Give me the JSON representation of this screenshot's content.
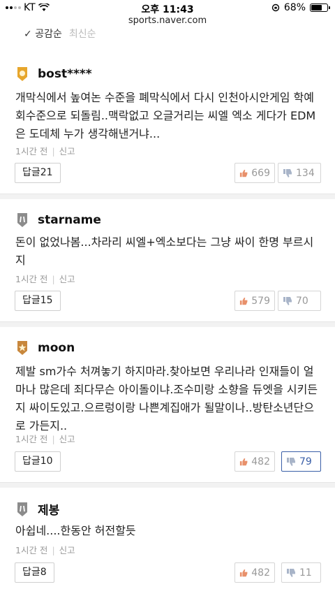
{
  "status_bar": {
    "carrier": "KT",
    "time": "오후 11:43",
    "battery": "68%",
    "battery_level": 0.68
  },
  "url": "sports.naver.com",
  "sort_tabs": {
    "active": "공감순",
    "inactive": "최신순"
  },
  "comments": [
    {
      "author": "bost****",
      "badge": "gold-badge-icon",
      "text": "개막식에서 높여논 수준을 폐막식에서 다시 인천아시안게임 학예회수준으로 되돌림..맥락없고 오글거리는 씨엘 엑소 게다가 EDM은 도데체 누가 생각해낸거냐...",
      "time": "1시간 전",
      "report": "신고",
      "reply": "답글21",
      "likes": "669",
      "dislikes": "134"
    },
    {
      "author": "starname",
      "badge": "peace-badge-icon",
      "text": "돈이 없었나봄...차라리 씨엘+엑소보다는 그냥 싸이 한명 부르시지",
      "time": "1시간 전",
      "report": "신고",
      "reply": "답글15",
      "likes": "579",
      "dislikes": "70"
    },
    {
      "author": "moon",
      "badge": "star-badge-icon",
      "text": "제발 sm가수 처껴놓기 하지마라.찾아보면 우리나라 인재들이 얼마나 많은데 죄다무슨 아이돌이냐.조수미랑 소향을 듀엣을 시키든지 싸이도있고.으르렁이랑 나쁜계집애가 될말이나..방탄소년단으로 가든지..",
      "time": "1시간 전",
      "report": "신고",
      "reply": "답글10",
      "likes": "482",
      "dislikes": "79"
    },
    {
      "author": "제봉",
      "badge": "peace-badge-icon",
      "text": "아쉽네....한동안 허전할듯",
      "time": "1시간 전",
      "report": "신고",
      "reply": "답글8",
      "likes": "482",
      "dislikes": "11"
    }
  ],
  "colors": {
    "accent": "#3a5fa8",
    "like_icon": "#e8906a",
    "dislike_icon": "#a8b4c8"
  }
}
